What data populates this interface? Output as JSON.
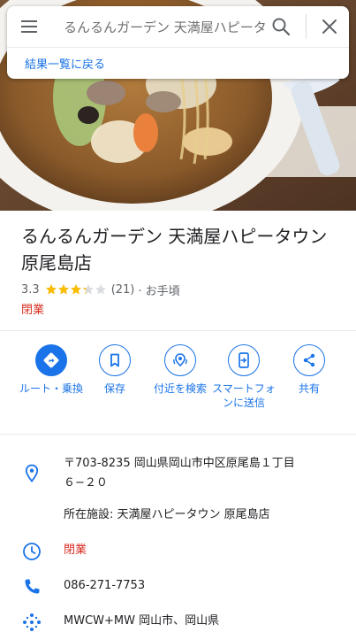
{
  "search": {
    "query": "るんるんガーデン 天満屋ハピータ"
  },
  "nav": {
    "back_to_results": "結果一覧に戻る"
  },
  "place": {
    "name": "るんるんガーデン 天満屋ハピータウン原尾島店",
    "rating": "3.3",
    "rating_value": 3.3,
    "rating_max": 5,
    "review_count": "(21)",
    "price_level": "· お手頃",
    "status": "閉業"
  },
  "actions": [
    {
      "label": "ルート・乗換",
      "icon": "directions-icon"
    },
    {
      "label": "保存",
      "icon": "bookmark-icon"
    },
    {
      "label": "付近を検索",
      "icon": "nearby-search-icon"
    },
    {
      "label": "スマートフォンに送信",
      "icon": "send-to-phone-icon"
    },
    {
      "label": "共有",
      "icon": "share-icon"
    }
  ],
  "info": {
    "address_line1": "〒703-8235 岡山県岡山市中区原尾島１丁目",
    "address_line2": "６−２０",
    "located_in": "所在施設: 天満屋ハピータウン 原尾島店",
    "hours_status": "閉業",
    "phone": "086-271-7753",
    "plus_code": "MWCW+MW 岡山市、岡山県"
  },
  "colors": {
    "accent": "#1a73e8",
    "closed": "#d93025",
    "star": "#fbbc04"
  }
}
